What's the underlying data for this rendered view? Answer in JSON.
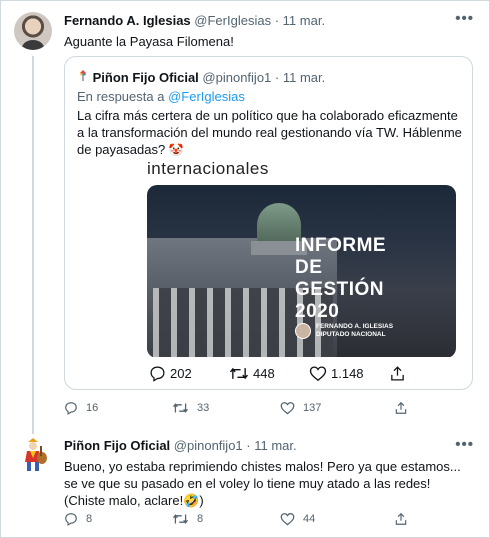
{
  "tweet1": {
    "name": "Fernando A. Iglesias",
    "handle": "@FerIglesias",
    "dot": "·",
    "date": "11 mar.",
    "text": "Aguante la Payasa Filomena!",
    "more": "•••",
    "actions": {
      "replies": "16",
      "retweets": "33",
      "likes": "137"
    }
  },
  "quote": {
    "name": "Piñon Fijo Oficial",
    "handle": "@pinonfijo1",
    "dot": "·",
    "date": "11 mar.",
    "reply_prefix": "En respuesta a",
    "reply_handle": "@FerIglesias",
    "text": "La cifra más certera de un político que ha colaborado eficazmente a la transformación del mundo real gestionando vía TW. Háblenme de payasadas?",
    "emoji": "🤡",
    "image": {
      "top_text": "internacionales",
      "title_lines": [
        "INFORME",
        "DE",
        "GESTIÓN",
        "2020"
      ],
      "author_lines": [
        "FERNANDO A. IGLESIAS",
        "DIPUTADO NACIONAL"
      ]
    },
    "actions": {
      "replies": "202",
      "retweets": "448",
      "likes": "1.148"
    }
  },
  "tweet2": {
    "name": "Piñon Fijo Oficial",
    "handle": "@pinonfijo1",
    "dot": "·",
    "date": "11 mar.",
    "text": "Bueno, yo estaba reprimiendo chistes malos! Pero ya que estamos... se ve que su pasado en el voley lo tiene muy atado a las redes! (Chiste malo, aclare!🤣)",
    "more": "•••",
    "actions": {
      "replies": "8",
      "retweets": "8",
      "likes": "44"
    }
  },
  "colors": {
    "text": "#0f1419",
    "muted": "#536471",
    "link": "#1d9bf0",
    "border": "#cfd9de"
  }
}
